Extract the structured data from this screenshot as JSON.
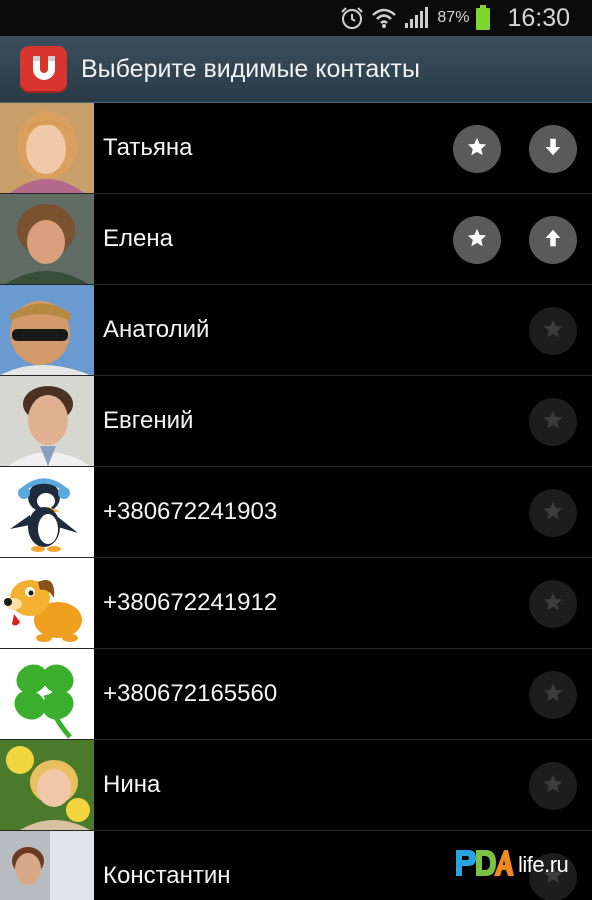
{
  "status_bar": {
    "icons": [
      "alarm-icon",
      "wifi-icon",
      "signal-icon",
      "battery-icon"
    ],
    "battery": "87%",
    "time": "16:30"
  },
  "app_bar": {
    "icon": "magnet-icon",
    "title": "Выберите видимые контакты"
  },
  "contacts": [
    {
      "name": "Татьяна",
      "starred": true,
      "move": "down",
      "avatar": "portrait"
    },
    {
      "name": "Елена",
      "starred": true,
      "move": "up",
      "avatar": "portrait"
    },
    {
      "name": "Анатолий",
      "starred": false,
      "avatar": "portrait"
    },
    {
      "name": "Евгений",
      "starred": false,
      "avatar": "portrait"
    },
    {
      "name": "+380672241903",
      "starred": false,
      "avatar": "penguin"
    },
    {
      "name": "+380672241912",
      "starred": false,
      "avatar": "dog"
    },
    {
      "name": "+380672165560",
      "starred": false,
      "avatar": "clover"
    },
    {
      "name": "Нина",
      "starred": false,
      "avatar": "portrait"
    },
    {
      "name": "Константин",
      "starred": false,
      "avatar": "portrait"
    }
  ],
  "watermark": {
    "logo": "PDA",
    "text": "life.ru"
  },
  "colors": {
    "background": "#000000",
    "app_bar": "#33444f",
    "app_icon": "#d8352f",
    "active_button": "#5a5a5a",
    "inactive_button": "#1d1d1d"
  }
}
